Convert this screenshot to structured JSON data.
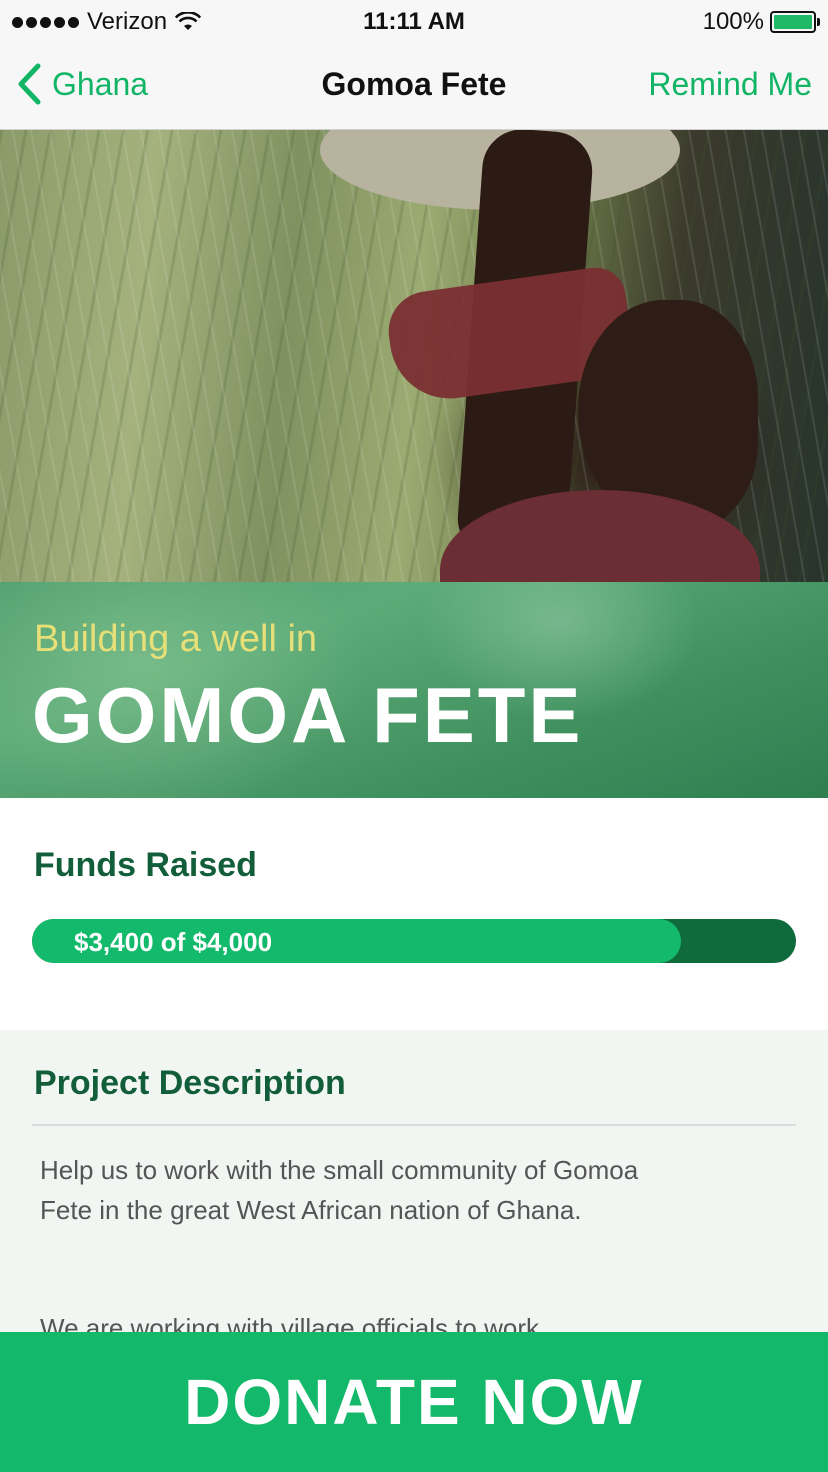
{
  "status_bar": {
    "carrier": "Verizon",
    "time": "11:11 AM",
    "battery_text": "100%",
    "battery_level": 1.0,
    "accent_color": "#1fb866"
  },
  "nav": {
    "back_label": "Ghana",
    "title": "Gomoa Fete",
    "right_action": "Remind Me",
    "accent_color": "#12b466"
  },
  "hero": {
    "image_icon": "photo-hero"
  },
  "banner": {
    "subtitle": "Building a well in",
    "title": "GOMOA FETE"
  },
  "funds": {
    "label": "Funds Raised",
    "progress_text": "$3,400 of $4,000",
    "raised": 3400,
    "goal": 4000,
    "fill_color": "#14ba6c",
    "track_color": "#0f6a3c"
  },
  "description": {
    "title": "Project Description",
    "paragraph_1": "Help us to work with the small community of Gomoa Fete in the great West African nation of Ghana.",
    "paragraph_2": "We are working with village officials to work"
  },
  "donate": {
    "label": "DONATE NOW",
    "color": "#13b86a"
  }
}
